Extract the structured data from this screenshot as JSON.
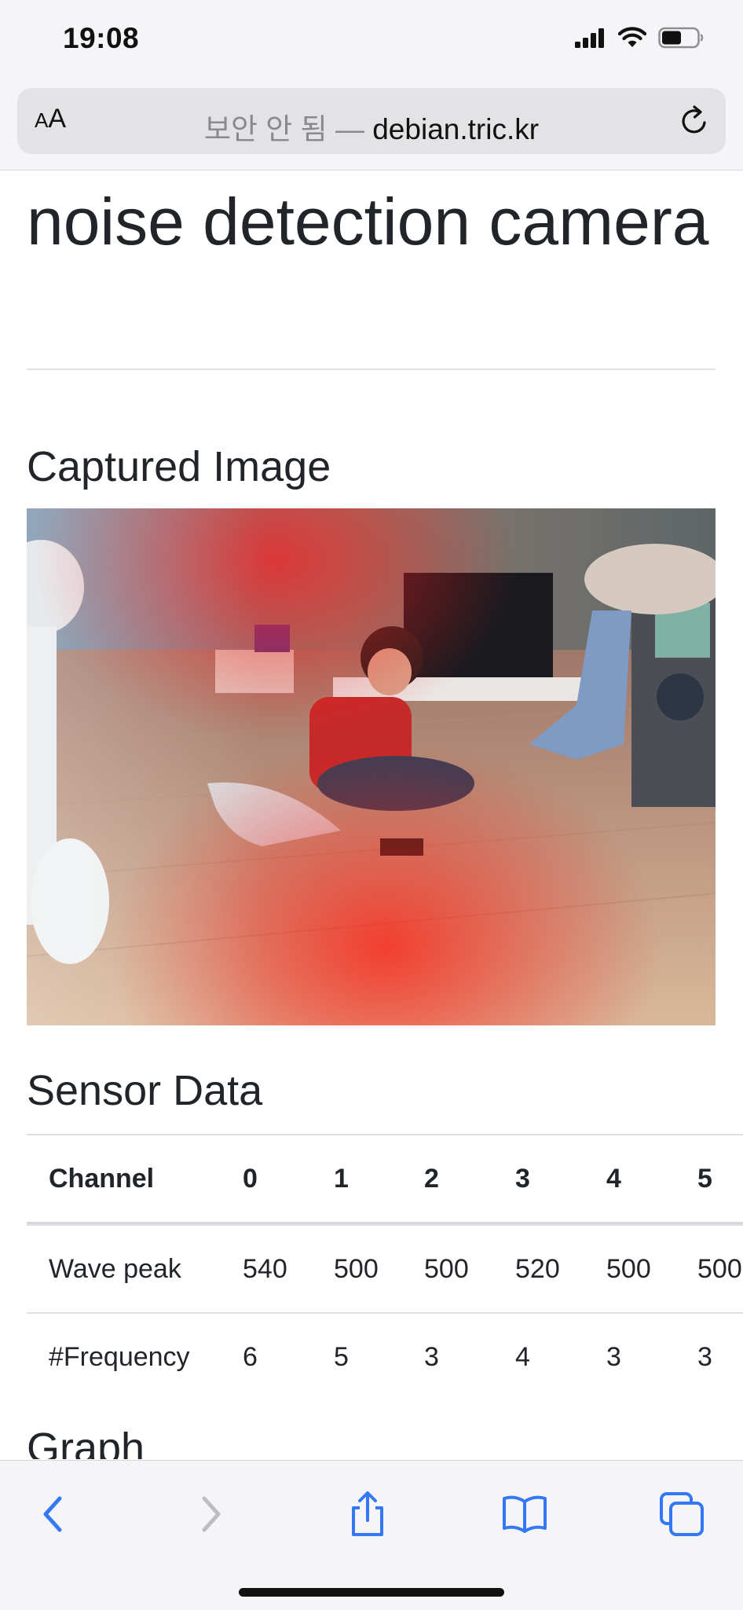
{
  "status_bar": {
    "time": "19:08"
  },
  "browser": {
    "text_size_label_small": "A",
    "text_size_label_large": "A",
    "security_label": "보안 안 됨",
    "separator": " — ",
    "domain": "debian.tric.kr"
  },
  "page": {
    "title": "noise detection camera",
    "captured_heading": "Captured Image",
    "sensor_heading": "Sensor Data",
    "graph_heading": "Graph"
  },
  "sensor_table": {
    "headers": [
      "Channel",
      "0",
      "1",
      "2",
      "3",
      "4",
      "5"
    ],
    "rows": [
      [
        "Wave peak",
        "540",
        "500",
        "500",
        "520",
        "500",
        "500"
      ],
      [
        "#Frequency",
        "6",
        "5",
        "3",
        "4",
        "3",
        "3"
      ]
    ]
  },
  "colors": {
    "ios_blue": "#3478f6",
    "text": "#212529",
    "overlay_red": "#ff2020"
  },
  "icons": [
    "back-icon",
    "forward-icon",
    "share-icon",
    "bookmarks-icon",
    "tabs-icon",
    "reload-icon",
    "signal-icon",
    "wifi-icon",
    "battery-icon"
  ]
}
